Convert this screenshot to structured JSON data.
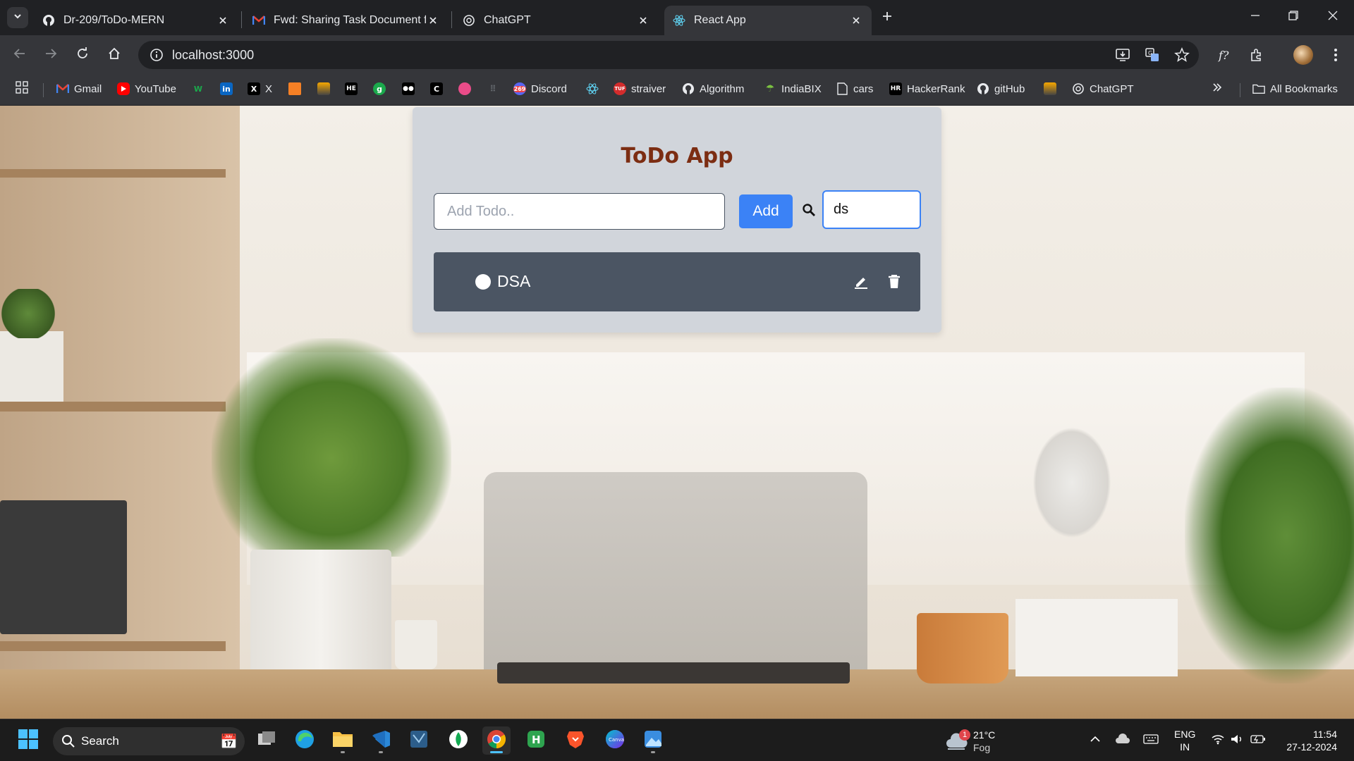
{
  "browser": {
    "tabs": [
      {
        "title": "Dr-209/ToDo-MERN",
        "icon": "github-icon"
      },
      {
        "title": "Fwd: Sharing Task Document fo",
        "icon": "gmail-icon"
      },
      {
        "title": "ChatGPT",
        "icon": "chatgpt-icon"
      },
      {
        "title": "React App",
        "icon": "react-icon",
        "active": true
      }
    ],
    "url": "localhost:3000",
    "bookmarks": [
      {
        "label": "Gmail",
        "icon": "gmail-icon"
      },
      {
        "label": "YouTube",
        "icon": "youtube-icon"
      },
      {
        "label": "",
        "icon": "w-icon"
      },
      {
        "label": "",
        "icon": "linkedin-icon"
      },
      {
        "label": "X",
        "icon": "x-icon"
      },
      {
        "label": "",
        "icon": "orange-icon"
      },
      {
        "label": "",
        "icon": "stack-icon"
      },
      {
        "label": "",
        "icon": "hackerearth-icon"
      },
      {
        "label": "",
        "icon": "green-icon"
      },
      {
        "label": "",
        "icon": "medium-icon"
      },
      {
        "label": "",
        "icon": "c-icon"
      },
      {
        "label": "",
        "icon": "dribbble-icon"
      },
      {
        "label": "",
        "icon": "grid-icon"
      },
      {
        "label": "Discord",
        "icon": "discord-icon",
        "badge": "269"
      },
      {
        "label": "",
        "icon": "react-icon"
      },
      {
        "label": "straiver",
        "icon": "tuf-icon"
      },
      {
        "label": "Algorithm",
        "icon": "github-icon"
      },
      {
        "label": "IndiaBIX",
        "icon": "indiabix-icon"
      },
      {
        "label": "cars",
        "icon": "doc-icon"
      },
      {
        "label": "HackerRank",
        "icon": "hackerrank-icon"
      },
      {
        "label": "gitHub",
        "icon": "github-icon"
      },
      {
        "label": "",
        "icon": "stack-icon"
      },
      {
        "label": "ChatGPT",
        "icon": "chatgpt-icon"
      }
    ],
    "all_bookmarks_label": "All Bookmarks"
  },
  "app": {
    "title": "ToDo App",
    "add_placeholder": "Add Todo..",
    "add_value": "",
    "add_button": "Add",
    "search_value": "ds",
    "todos": [
      {
        "text": "DSA",
        "completed": false
      }
    ]
  },
  "taskbar": {
    "search_label": "Search",
    "weather_temp": "21°C",
    "weather_condition": "Fog",
    "weather_badge": "1",
    "language_top": "ENG",
    "language_bottom": "IN",
    "time": "11:54",
    "date": "27-12-2024"
  },
  "colors": {
    "accent": "#3b82f6",
    "title": "#7c2d12",
    "card": "#d1d5db",
    "todo_item": "#4b5563"
  }
}
